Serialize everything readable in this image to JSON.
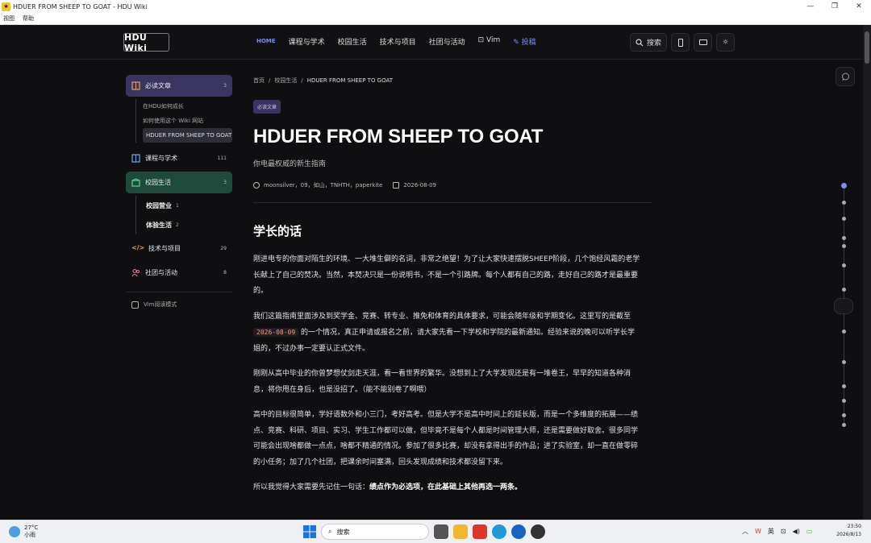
{
  "window": {
    "title": "HDUER FROM SHEEP TO GOAT - HDU Wiki",
    "menu": [
      "视图",
      "帮助"
    ]
  },
  "nav": {
    "logo": "HDU Wiki",
    "links": [
      {
        "label": "HOME",
        "active": true
      },
      {
        "label": "课程与学术"
      },
      {
        "label": "校园生活"
      },
      {
        "label": "技术与项目"
      },
      {
        "label": "社团与活动"
      },
      {
        "label": "Vim"
      },
      {
        "label": "投稿"
      }
    ],
    "search_label": "搜索"
  },
  "sidebar": {
    "sections": [
      {
        "label": "必读文章",
        "count": "3",
        "children": [
          "在HDU如何成长",
          "如何使用这个 Wiki 网站",
          "HDUER FROM SHEEP TO GOAT"
        ]
      },
      {
        "label": "课程与学术",
        "count": "111"
      },
      {
        "label": "校园生活",
        "count": "3",
        "children": [
          {
            "label": "校园营业",
            "count": "1"
          },
          {
            "label": "体验生活",
            "count": "2"
          }
        ]
      },
      {
        "label": "技术与项目",
        "count": "29"
      },
      {
        "label": "社团与活动",
        "count": "8"
      }
    ],
    "vim_mode": "Vim阅读模式"
  },
  "article": {
    "breadcrumb": [
      "首页",
      "校园生活",
      "HDUER FROM SHEEP TO GOAT"
    ],
    "tag": "必读文章",
    "title": "HDUER FROM SHEEP TO GOAT",
    "subtitle": "你电最权威的新生指南",
    "authors": "moonsilver，09，如山，TNHTH，paperkite",
    "date": "2026-08-09",
    "section_heading": "学长的话",
    "p1": "刚进电专的你面对陌生的环境、一大堆生僻的名词，非常之绝望！为了让大家快速摆脱SHEEP阶段，几个饱经风霜的老学长献上了自己的焚决。当然，本焚决只是一份说明书，不是一个引路牌。每个人都有自己的路，走好自己的路才是最重要的。",
    "p2_a": "我们这篇指南里面涉及到奖学金、竞赛、转专业、推免和体育的具体要求，可能会随年级和学期变化。这里写的是截至",
    "p2_code": "2026-08-09",
    "p2_b": "的一个情况，真正申请或报名之前，请大家先看一下学校和学院的最新通知。经验来说的晚可以听学长学姐的，不过办事一定要认正式文件。",
    "p3": "刚刚从高中毕业的你曾梦想仗剑走天涯，看一看世界的繁华。没想到上了大学发现还是有一堆卷王，早早的知道各种消息，将你甩在身后，也是没招了。（能不能别卷了啊喂）",
    "p4": "高中的目标很简单，学好语数外和小三门，考好高考。但是大学不是高中时间上的延长版，而是一个多维度的拓展——绩点、竞赛、科研、项目、实习、学生工作都可以做，但毕竟不是每个人都是时间管理大师，还是需要做好取舍。很多同学可能会出现啥都做一点点，啥都不精通的情况。参加了很多比赛，却没有拿得出手的作品；进了实验室，却一直在做零碎的小任务；加了几个社团，把课余时间塞满，回头发现成绩和技术都没留下来。",
    "p5_a": "所以我觉得大家需要先记住一句话：",
    "p5_b": "绩点作为必选项，在此基础上其他再选一两条。"
  },
  "taskbar": {
    "weather_temp": "27°C",
    "weather_desc": "小雨",
    "search_placeholder": "搜索",
    "ime": "英",
    "time": "23:50",
    "date": "2026/8/13"
  },
  "colors": {
    "accent": "#7c8cf0",
    "bg": "#0f0f12",
    "selected": "#3a3560",
    "green": "#1e4a3c"
  }
}
